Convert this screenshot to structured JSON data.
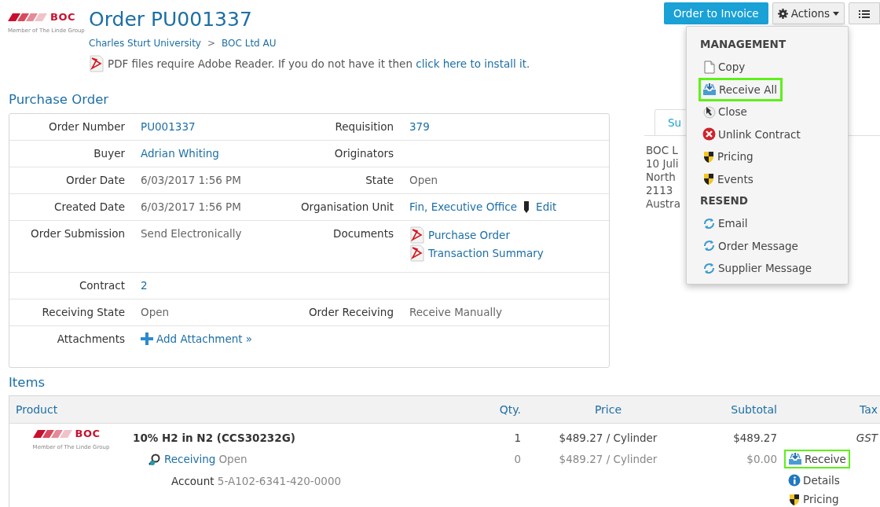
{
  "logo": {
    "wordmark": "BOC",
    "tagline": "Member of The Linde Group"
  },
  "title": "Order PU001337",
  "breadcrumb": {
    "separator": ">",
    "items": [
      "Charles Sturt University",
      "BOC Ltd AU"
    ]
  },
  "pdf_notice": {
    "text": "PDF files require Adobe Reader. If you do not have it then",
    "link": "click here to install it."
  },
  "toolbar": {
    "primary": "Order to Invoice",
    "actions": "Actions",
    "actions_expanded": true
  },
  "actions_menu": [
    {
      "kind": "header",
      "label": "MANAGEMENT"
    },
    {
      "kind": "item",
      "label": "Copy",
      "highlighted": false
    },
    {
      "kind": "item",
      "label": "Receive All",
      "highlighted": true
    },
    {
      "kind": "item",
      "label": "Close",
      "highlighted": false
    },
    {
      "kind": "item",
      "label": "Unlink Contract",
      "highlighted": false
    },
    {
      "kind": "item",
      "label": "Pricing",
      "highlighted": false
    },
    {
      "kind": "item",
      "label": "Events",
      "highlighted": false
    },
    {
      "kind": "header",
      "label": "RESEND"
    },
    {
      "kind": "item",
      "label": "Email",
      "highlighted": false
    },
    {
      "kind": "item",
      "label": "Order Message",
      "highlighted": false
    },
    {
      "kind": "item",
      "label": "Supplier Message",
      "highlighted": false
    }
  ],
  "purchase_order": {
    "heading": "Purchase Order",
    "rows": [
      [
        {
          "label": "Order Number",
          "kind": "link",
          "value": "PU001337"
        },
        {
          "label": "Requisition",
          "kind": "link",
          "value": "379"
        }
      ],
      [
        {
          "label": "Buyer",
          "kind": "link",
          "value": "Adrian Whiting"
        },
        {
          "label": "Originators",
          "kind": "text"
        }
      ],
      [
        {
          "label": "Order Date",
          "kind": "text",
          "value": "6/03/2017 1:56 PM"
        },
        {
          "label": "State",
          "kind": "text",
          "value": "Open"
        }
      ],
      [
        {
          "label": "Created Date",
          "kind": "text",
          "value": "6/03/2017 1:56 PM"
        },
        {
          "label": "Organisation Unit",
          "kind": "link",
          "value": "Fin, Executive Office",
          "edit": "Edit"
        }
      ],
      [
        {
          "label": "Order Submission",
          "kind": "text",
          "value": "Send Electronically"
        },
        {
          "label": "Documents",
          "kind": "documents",
          "values": [
            "Purchase Order",
            "Transaction Summary"
          ]
        }
      ],
      [
        {
          "label": "Contract",
          "kind": "link",
          "value": "2"
        }
      ],
      [
        {
          "label": "Receiving State",
          "kind": "text",
          "value": "Open"
        },
        {
          "label": "Order Receiving",
          "kind": "text",
          "value": "Receive Manually"
        }
      ],
      [
        {
          "label": "Attachments",
          "kind": "add",
          "value": "Add Attachment »"
        }
      ]
    ]
  },
  "supplier_panel": {
    "tab": "Su",
    "lines": [
      "BOC L",
      "10 Juli",
      "North",
      "2113",
      "Austra"
    ]
  },
  "items": {
    "heading": "Items",
    "columns": [
      "Product",
      "Qty.",
      "Price",
      "Subtotal",
      "Tax"
    ],
    "rows": [
      {
        "logo": {
          "wordmark": "BOC",
          "tagline": "Member of The Linde Group"
        },
        "name": "10% H2 in N2 (CCS30232G)",
        "qty": "1",
        "price": "$489.27",
        "unit": "/ Cylinder",
        "subtotal": "$489.27",
        "tax": "GST",
        "receiving": {
          "label": "Receiving",
          "state": "Open",
          "qty": "0",
          "price": "$489.27",
          "unit": "/ Cylinder",
          "subtotal": "$0.00"
        },
        "account": {
          "label": "Account",
          "value": "5-A102-6341-420-0000"
        },
        "actions": [
          {
            "label": "Receive",
            "highlighted": true
          },
          {
            "label": "Details",
            "highlighted": false
          },
          {
            "label": "Pricing",
            "highlighted": false
          }
        ]
      }
    ]
  }
}
